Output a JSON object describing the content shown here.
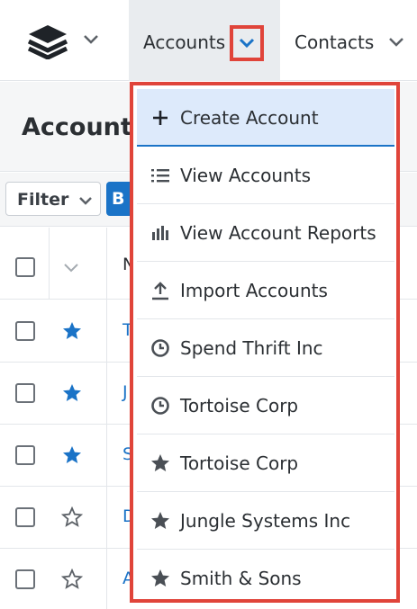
{
  "nav": {
    "module_tab": "Accounts",
    "contacts_tab": "Contacts"
  },
  "page": {
    "title": "Accounts"
  },
  "filterbar": {
    "filter_label": "Filter",
    "blue_button_label": "B"
  },
  "list": {
    "header_col": "N",
    "rows": [
      {
        "name": "T",
        "favorite": true
      },
      {
        "name": "J",
        "favorite": true
      },
      {
        "name": "S",
        "favorite": true
      },
      {
        "name": "D",
        "favorite": false
      },
      {
        "name": "A",
        "favorite": false
      }
    ]
  },
  "dropdown": {
    "items": [
      {
        "label": "Create Account",
        "icon": "plus-icon"
      },
      {
        "label": "View Accounts",
        "icon": "list-icon"
      },
      {
        "label": "View Account Reports",
        "icon": "bar-chart-icon"
      },
      {
        "label": "Import Accounts",
        "icon": "upload-icon"
      },
      {
        "label": "Spend Thrift Inc",
        "icon": "clock-icon"
      },
      {
        "label": "Tortoise Corp",
        "icon": "clock-icon"
      },
      {
        "label": "Tortoise Corp",
        "icon": "star-icon"
      },
      {
        "label": "Jungle Systems Inc",
        "icon": "star-icon"
      },
      {
        "label": "Smith & Sons",
        "icon": "star-icon"
      }
    ]
  },
  "colors": {
    "accent": "#1a73c7",
    "highlight_border": "#e0443a",
    "active_item_bg": "#ddeafb"
  }
}
